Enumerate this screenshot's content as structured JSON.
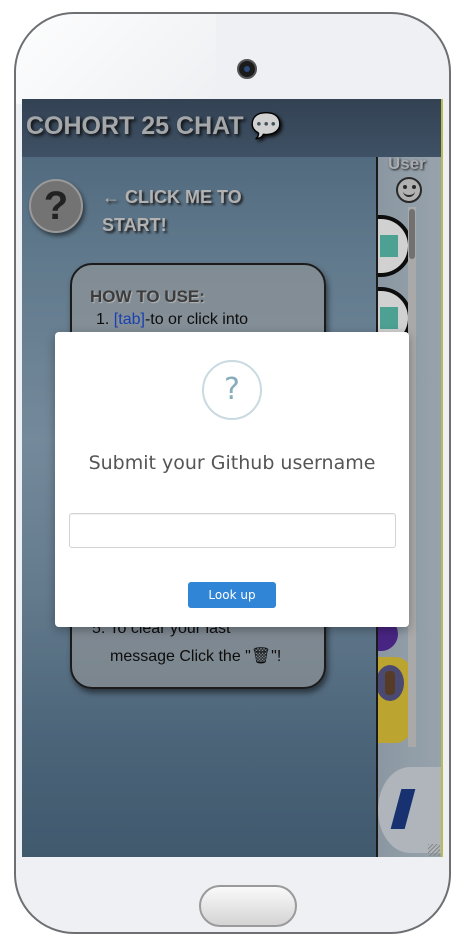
{
  "header": {
    "title": "COHORT 25 CHAT 💬"
  },
  "start_prompt": {
    "help_icon": "?",
    "lines": [
      "← CLICK ME TO",
      "START!"
    ]
  },
  "how_to": {
    "title": "HOW TO USE:",
    "step1_num": "1.",
    "step1_key": "[tab]",
    "step1_text": "-to or click into",
    "step5_line1": "5. To clear your last",
    "step5_line2": "message Click the \"🗑\"!"
  },
  "sidebar": {
    "header": "User",
    "icon": "smile-icon"
  },
  "modal": {
    "icon": "?",
    "title": "Submit your Github username",
    "input_value": "",
    "button_label": "Look up"
  },
  "colors": {
    "button": "#3085d6",
    "header_bg": "#4d637b",
    "sidebar_edge": "#e4e46a"
  }
}
